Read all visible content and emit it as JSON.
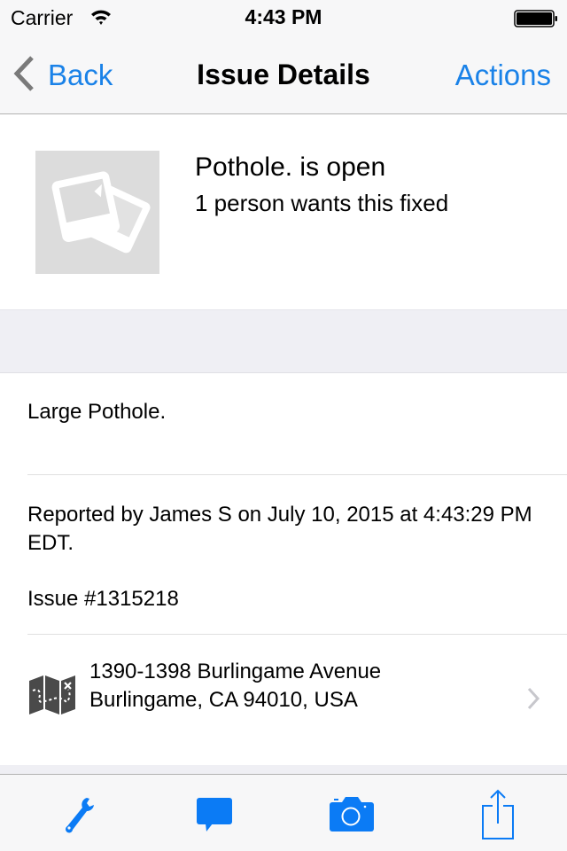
{
  "status_bar": {
    "carrier": "Carrier",
    "time": "4:43 PM",
    "wifi_icon": "wifi-icon",
    "battery_icon": "battery-full-icon"
  },
  "nav": {
    "back_label": "Back",
    "title": "Issue Details",
    "actions_label": "Actions",
    "back_icon": "chevron-left-icon"
  },
  "issue": {
    "thumbnail_icon": "photo-placeholder-icon",
    "status_line": "Pothole. is open",
    "supporters_line": "1 person wants this fixed",
    "description": "Large Pothole.",
    "reported_line": "Reported by James S on July 10, 2015 at 4:43:29 PM EDT.",
    "issue_number": "Issue #1315218"
  },
  "address": {
    "map_icon": "map-icon",
    "line1": "1390-1398 Burlingame Avenue",
    "line2": "Burlingame, CA 94010, USA",
    "disclosure_icon": "chevron-right-icon"
  },
  "toolbar": {
    "items": [
      {
        "name": "wrench",
        "icon": "wrench-icon"
      },
      {
        "name": "comment",
        "icon": "speech-bubble-icon"
      },
      {
        "name": "camera",
        "icon": "camera-icon"
      },
      {
        "name": "share",
        "icon": "share-icon"
      }
    ]
  },
  "colors": {
    "accent": "#1a82e8",
    "toolbar_icon": "#0b7bf5",
    "bar_background": "#f7f7f8",
    "group_background": "#efeff4",
    "thumbnail_background": "#dcdcdc",
    "map_icon": "#4a4a4a",
    "disclosure": "#c7c7cc"
  }
}
